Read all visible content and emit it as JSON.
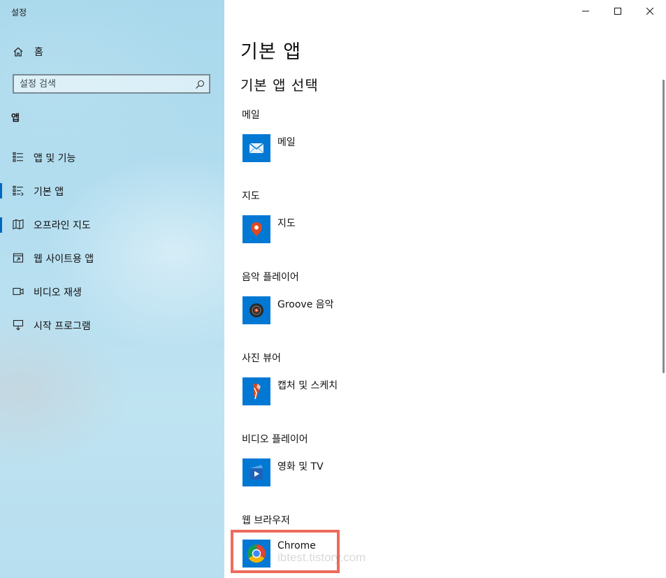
{
  "window": {
    "title": "설정"
  },
  "sidebar": {
    "home_label": "홈",
    "search": {
      "placeholder": "설정 검색"
    },
    "section_title": "앱",
    "items": [
      {
        "label": "앱 및 기능",
        "icon": "apps-features-icon",
        "selected": false
      },
      {
        "label": "기본 앱",
        "icon": "default-apps-icon",
        "selected": true
      },
      {
        "label": "오프라인 지도",
        "icon": "offline-maps-icon",
        "selected": false
      },
      {
        "label": "웹 사이트용 앱",
        "icon": "apps-for-websites-icon",
        "selected": false
      },
      {
        "label": "비디오 재생",
        "icon": "video-playback-icon",
        "selected": false
      },
      {
        "label": "시작 프로그램",
        "icon": "startup-icon",
        "selected": false
      }
    ]
  },
  "content": {
    "page_title": "기본 앱",
    "subtitle": "기본 앱 선택",
    "defaults": [
      {
        "category": "메일",
        "app": "메일",
        "icon": "mail-app-icon"
      },
      {
        "category": "지도",
        "app": "지도",
        "icon": "maps-app-icon"
      },
      {
        "category": "음악 플레이어",
        "app": "Groove 음악",
        "icon": "groove-music-icon"
      },
      {
        "category": "사진 뷰어",
        "app": "캡처 및 스케치",
        "icon": "snip-sketch-icon"
      },
      {
        "category": "비디오 플레이어",
        "app": "영화 및 TV",
        "icon": "movies-tv-icon"
      },
      {
        "category": "웹 브라우저",
        "app": "Chrome",
        "icon": "chrome-icon"
      }
    ]
  },
  "watermark": "ibtest.tistory.com",
  "colors": {
    "accent": "#0067c0",
    "tile": "#0078d4",
    "highlight": "#ee6a5c"
  }
}
